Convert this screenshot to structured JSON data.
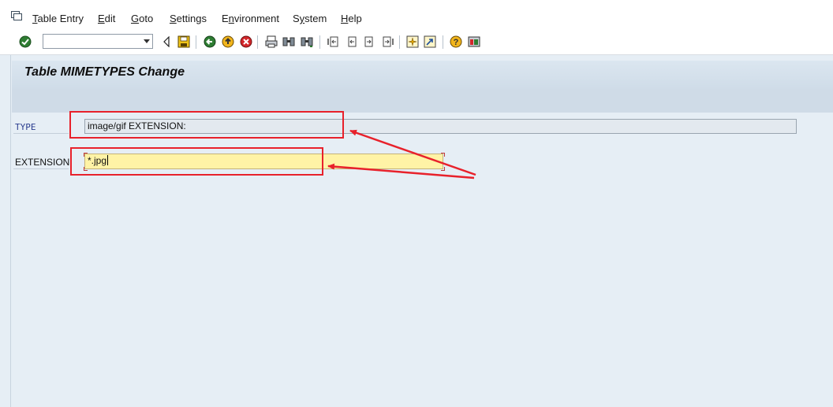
{
  "menu": {
    "items": [
      {
        "label": "Table Entry",
        "underline": "T",
        "rest": "able Entry"
      },
      {
        "label": "Edit",
        "underline": "E",
        "rest": "dit"
      },
      {
        "label": "Goto",
        "underline": "G",
        "rest": "oto"
      },
      {
        "label": "Settings",
        "underline": "S",
        "rest": "ettings"
      },
      {
        "label": "Environment",
        "underline": "n",
        "pre": "E",
        "rest": "vironment"
      },
      {
        "label": "System",
        "underline": "y",
        "pre": "S",
        "rest": "stem"
      },
      {
        "label": "Help",
        "underline": "H",
        "rest": "elp"
      }
    ]
  },
  "toolbar": {
    "command_value": "",
    "icons": [
      "enter-icon",
      "back-triangle-icon",
      "save-icon",
      "back-icon",
      "exit-icon",
      "cancel-icon",
      "print-icon",
      "find-icon",
      "find-next-icon",
      "first-page-icon",
      "previous-page-icon",
      "next-page-icon",
      "last-page-icon",
      "create-session-icon",
      "shortcut-icon",
      "help-icon",
      "customize-layout-icon"
    ]
  },
  "title": {
    "text": "Table MIMETYPES Change"
  },
  "form": {
    "type_label": "TYPE",
    "type_value": "image/gif EXTENSION:",
    "extension_label": "EXTENSION",
    "extension_value": "*.jpg"
  },
  "colors": {
    "annotation_red": "#e8212b",
    "field_yellow": "#fff3a6",
    "background": "#e6eef5"
  }
}
